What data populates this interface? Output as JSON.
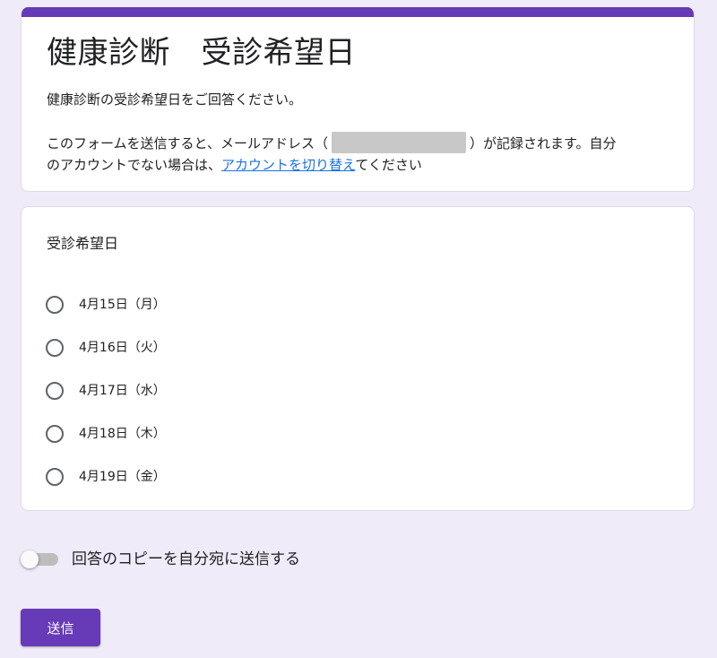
{
  "theme": {
    "accent": "#673ab7",
    "background": "#f0ebf8",
    "link": "#1a73e8"
  },
  "header": {
    "title": "健康診断　受診希望日",
    "description": "健康診断の受診希望日をご回答ください。",
    "notice_part1": "このフォームを送信すると、メールアドレス（",
    "notice_part2": "）が記録されます。自分",
    "notice_part3": "のアカウントでない場合は、",
    "switch_account_link": "アカウントを切り替え",
    "notice_part4": "てください"
  },
  "question": {
    "title": "受診希望日",
    "options": [
      {
        "label": "4月15日（月）"
      },
      {
        "label": "4月16日（火）"
      },
      {
        "label": "4月17日（水）"
      },
      {
        "label": "4月18日（木）"
      },
      {
        "label": "4月19日（金）"
      }
    ]
  },
  "copy_toggle": {
    "label": "回答のコピーを自分宛に送信する",
    "checked": false
  },
  "submit": {
    "label": "送信"
  }
}
